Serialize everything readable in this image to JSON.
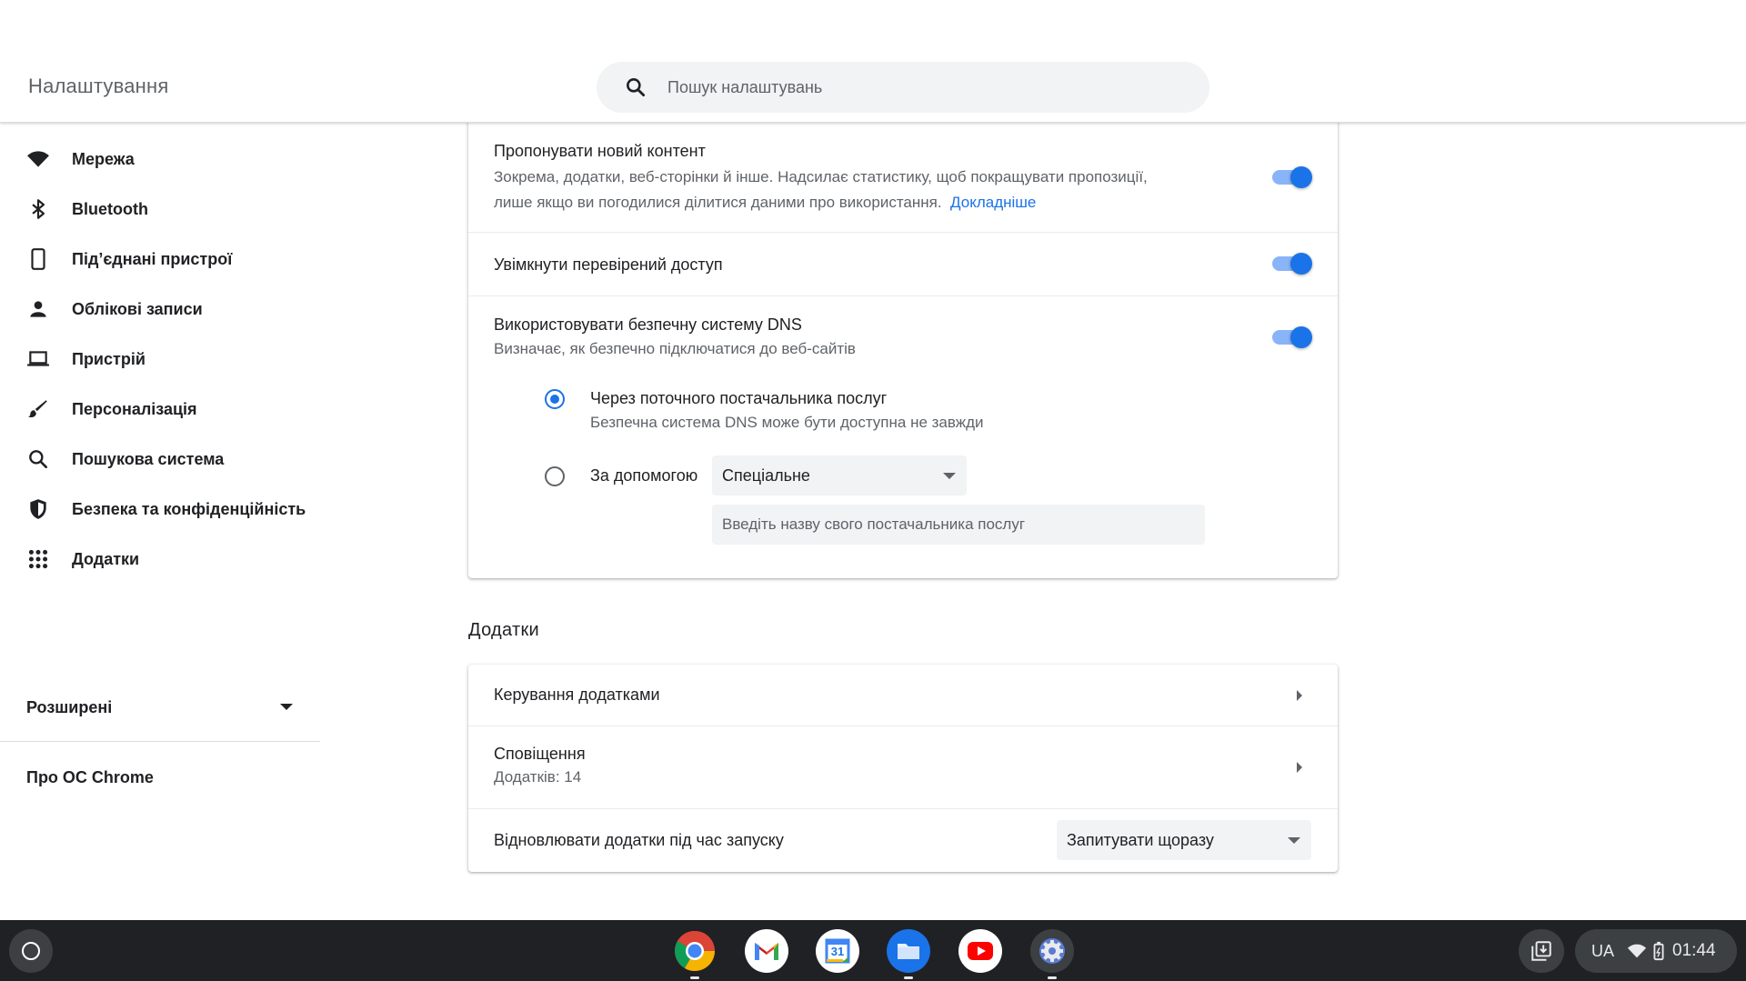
{
  "window": {
    "minimize_icon": "minimize-icon",
    "restore_icon": "restore-icon",
    "close_icon": "close-icon"
  },
  "header": {
    "title": "Налаштування",
    "search_placeholder": "Пошук налаштувань"
  },
  "sidebar": {
    "items": [
      {
        "label": "Мережа",
        "icon": "wifi-icon"
      },
      {
        "label": "Bluetooth",
        "icon": "bluetooth-icon"
      },
      {
        "label": "Під’єднані пристрої",
        "icon": "phone-icon"
      },
      {
        "label": "Облікові записи",
        "icon": "person-icon"
      },
      {
        "label": "Пристрій",
        "icon": "laptop-icon"
      },
      {
        "label": "Персоналізація",
        "icon": "brush-icon"
      },
      {
        "label": "Пошукова система",
        "icon": "search-icon"
      },
      {
        "label": "Безпека та конфіденційність",
        "icon": "shield-icon"
      },
      {
        "label": "Додатки",
        "icon": "apps-grid-icon"
      }
    ],
    "advanced": "Розширені",
    "about": "Про ОС Chrome"
  },
  "privacy": {
    "suggest_title": "Пропонувати новий контент",
    "suggest_desc_1": "Зокрема, додатки, веб-сторінки й інше. Надсилає статистику, щоб покращувати пропозиції,",
    "suggest_desc_2": "лише якщо ви погодилися ділитися даними про використання.",
    "suggest_link": "Докладніше",
    "suggest_enabled": true,
    "verified_title": "Увімкнути перевірений доступ",
    "verified_enabled": true,
    "dns_title": "Використовувати безпечну систему DNS",
    "dns_desc": "Визначає, як безпечно підключатися до веб-сайтів",
    "dns_enabled": true,
    "dns_option1_title": "Через поточного постачальника послуг",
    "dns_option1_desc": "Безпечна система DNS може бути доступна не завжди",
    "dns_option2_label": "За допомогою",
    "dns_provider_selected": "Спеціальне",
    "dns_provider_placeholder": "Введіть назву свого постачальника послуг"
  },
  "apps": {
    "section_title": "Додатки",
    "manage_label": "Керування додатками",
    "notifications_label": "Сповіщення",
    "notifications_sub": "Додатків: 14",
    "restore_label": "Відновлювати додатки під час запуску",
    "restore_selected": "Запитувати щоразу"
  },
  "shelf": {
    "apps": [
      "chrome-icon",
      "gmail-icon",
      "calendar-icon",
      "files-icon",
      "youtube-icon",
      "settings-icon"
    ],
    "calendar_day": "31",
    "lang": "UA",
    "time": "01:44"
  },
  "colors": {
    "accent": "#1a73e8",
    "toggle_track": "#8ab4f8",
    "shelf": "#202124"
  }
}
